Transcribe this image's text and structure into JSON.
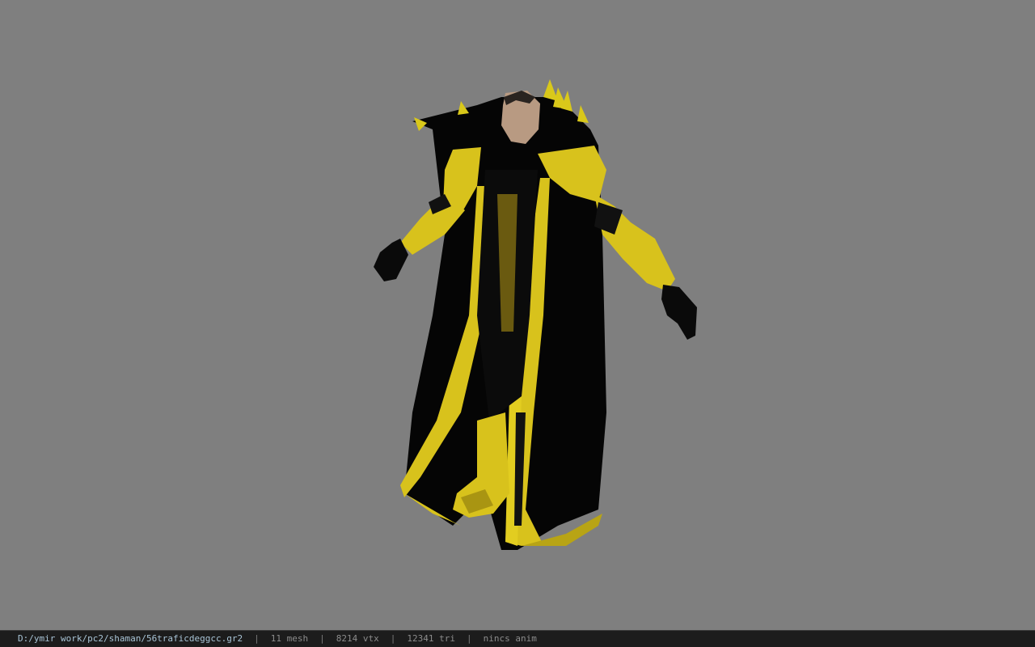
{
  "viewport": {
    "background": "#7f7f7f",
    "model_name": "shaman-character-model"
  },
  "status_bar": {
    "file_path": "D:/ymir work/pc2/shaman/56traficdeggcc.gr2",
    "separator": "|",
    "mesh_count": "11 mesh",
    "vertex_count": "8214 vtx",
    "triangle_count": "12341 tri",
    "animation": "nincs anim"
  }
}
